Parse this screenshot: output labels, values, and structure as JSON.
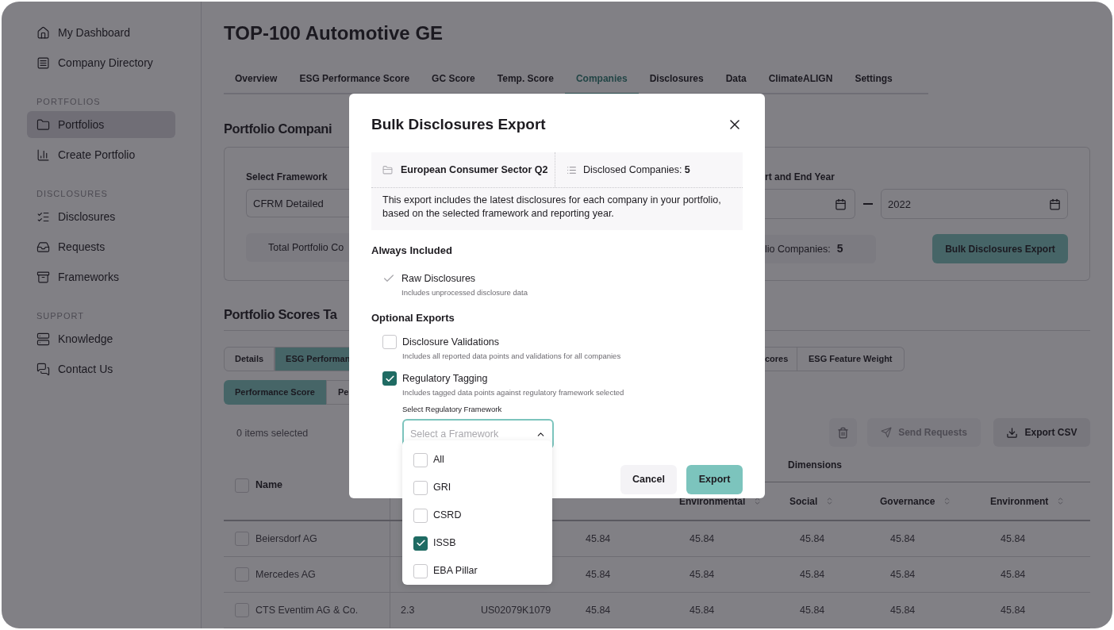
{
  "sidebar": {
    "sections": [
      {
        "items": [
          {
            "label": "My Dashboard",
            "selected": false
          },
          {
            "label": "Company Directory",
            "selected": false
          }
        ]
      },
      {
        "heading": "PORTFOLIOS",
        "items": [
          {
            "label": "Portfolios",
            "selected": true
          },
          {
            "label": "Create Portfolio",
            "selected": false
          }
        ]
      },
      {
        "heading": "DISCLOSURES",
        "items": [
          {
            "label": "Disclosures",
            "selected": false
          },
          {
            "label": "Requests",
            "selected": false
          },
          {
            "label": "Frameworks",
            "selected": false
          }
        ]
      },
      {
        "heading": "SUPPORT",
        "items": [
          {
            "label": "Knowledge",
            "selected": false
          },
          {
            "label": "Contact Us",
            "selected": false
          }
        ]
      }
    ]
  },
  "title": "TOP-100 Automotive GE",
  "tabs": [
    {
      "label": "Overview",
      "selected": false
    },
    {
      "label": "ESG Performance Score",
      "selected": false
    },
    {
      "label": "GC Score",
      "selected": false
    },
    {
      "label": "Temp. Score",
      "selected": false
    },
    {
      "label": "Companies",
      "selected": true
    },
    {
      "label": "Disclosures",
      "selected": false
    },
    {
      "label": "Data",
      "selected": false
    },
    {
      "label": "ClimateALIGN",
      "selected": false
    },
    {
      "label": "Settings",
      "selected": false
    }
  ],
  "portfolio_companies": {
    "heading": "Portfolio Compani",
    "framework_label": "Select Framework",
    "framework_value": "CFRM Detailed",
    "total_label": "Total Portfolio Co",
    "year_label": "rt and End Year",
    "end_year": "2022",
    "companies_label": "lio Companies:",
    "companies_count": "5",
    "export_button": "Bulk Disclosures Export"
  },
  "scores": {
    "heading": "Portfolio Scores Ta",
    "view_tabs_left": [
      {
        "label": "Details",
        "selected": false
      },
      {
        "label": "ESG Performan",
        "selected": true
      }
    ],
    "view_tabs_right": [
      {
        "label": "cores",
        "selected": false
      },
      {
        "label": "ESG Feature Weight",
        "selected": false
      }
    ],
    "sub_tabs": [
      {
        "label": "Performance Score",
        "selected": true
      },
      {
        "label": "Pe",
        "selected": false
      }
    ],
    "selection": "0 items selected",
    "send_requests": {
      "label": "Send Requests",
      "disabled": true
    },
    "export_csv": "Export CSV"
  },
  "table": {
    "group_header": "Dimensions",
    "select_all_checked": false,
    "columns": [
      {
        "label": "Name"
      },
      {},
      {},
      {},
      {
        "label": "Environmental",
        "sortable": true
      },
      {
        "label": "Social",
        "sortable": true
      },
      {
        "label": "Governance",
        "sortable": true
      },
      {
        "label": "Environment",
        "sortable": true
      }
    ],
    "rows": [
      {
        "checked": false,
        "cells": [
          "Beiersdorf AG",
          "",
          "",
          "45.84",
          "45.84",
          "45.84",
          "45.84",
          "45.84"
        ]
      },
      {
        "checked": false,
        "cells": [
          "Mercedes AG",
          "",
          "",
          "45.84",
          "45.84",
          "45.84",
          "45.84",
          "45.84"
        ]
      },
      {
        "checked": false,
        "cells": [
          "CTS Eventim AG & Co.",
          "2.3",
          "US02079K1079",
          "45.84",
          "45.84",
          "45.84",
          "45.84",
          "45.84"
        ]
      }
    ]
  },
  "modal": {
    "title": "Bulk Disclosures Export",
    "portfolio_name": "European Consumer Sector Q2",
    "disclosed": "Disclosed Companies: **5**",
    "description": "This export includes the latest disclosures for each company in your portfolio, based on the selected framework and reporting year.",
    "always_heading": "Always Included",
    "always_items": [
      {
        "label": "Raw Disclosures",
        "description": "Includes unprocessed disclosure data"
      }
    ],
    "optional_heading": "Optional Exports",
    "optional_items": [
      {
        "label": "Disclosure Validations",
        "description": "Includes all reported data points and validations for all companies",
        "checked": false
      },
      {
        "label": "Regulatory Tagging",
        "description": "Includes tagged data points against regulatory framework selected",
        "checked": true
      }
    ],
    "framework_select": {
      "label": "Select Regulatory Framework",
      "placeholder": "Select a Framework",
      "expanded": true,
      "options": [
        {
          "label": "All",
          "checked": false
        },
        {
          "label": "GRI",
          "checked": false
        },
        {
          "label": "CSRD",
          "checked": false
        },
        {
          "label": "ISSB",
          "checked": true
        },
        {
          "label": "EBA Pillar",
          "checked": false
        }
      ]
    },
    "cancel": "Cancel",
    "export": "Export"
  }
}
